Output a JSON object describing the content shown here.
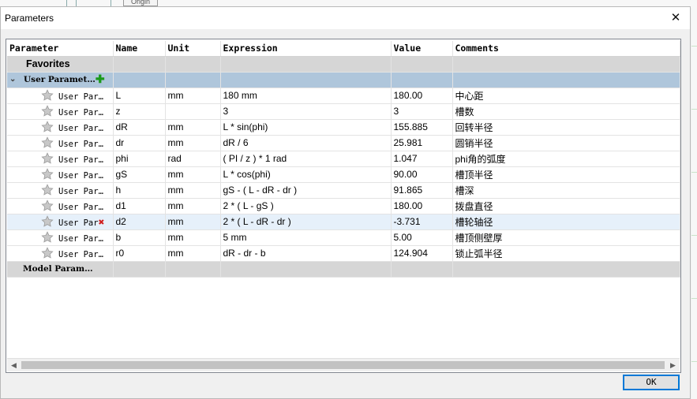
{
  "background": {
    "origin_label": "Origin"
  },
  "dialog": {
    "title": "Parameters",
    "close_glyph": "✕",
    "ok_label": "OK"
  },
  "columns": {
    "parameter": "Parameter",
    "name": "Name",
    "unit": "Unit",
    "expression": "Expression",
    "value": "Value",
    "comments": "Comments"
  },
  "groups": {
    "favorites": "Favorites",
    "user": "User Paramet…",
    "model": "Model Param…"
  },
  "rows": [
    {
      "param": "User Par…",
      "name": "L",
      "unit": "mm",
      "expr": "180 mm",
      "value": "180.00",
      "comment": "中心距"
    },
    {
      "param": "User Par…",
      "name": "z",
      "unit": "",
      "expr": "3",
      "value": "3",
      "comment": "槽数"
    },
    {
      "param": "User Par…",
      "name": "dR",
      "unit": "mm",
      "expr": "L * sin(phi)",
      "value": "155.885",
      "comment": "回转半径"
    },
    {
      "param": "User Par…",
      "name": "dr",
      "unit": "mm",
      "expr": "dR / 6",
      "value": "25.981",
      "comment": "圆销半径"
    },
    {
      "param": "User Par…",
      "name": "phi",
      "unit": "rad",
      "expr": "( PI / z ) * 1 rad",
      "value": "1.047",
      "comment": "phi角的弧度"
    },
    {
      "param": "User Par…",
      "name": "gS",
      "unit": "mm",
      "expr": "L * cos(phi)",
      "value": "90.00",
      "comment": "槽顶半径"
    },
    {
      "param": "User Par…",
      "name": "h",
      "unit": "mm",
      "expr": "gS - ( L - dR - dr )",
      "value": "91.865",
      "comment": "槽深"
    },
    {
      "param": "User Par…",
      "name": "d1",
      "unit": "mm",
      "expr": "2 * ( L - gS )",
      "value": "180.00",
      "comment": "拨盘直径"
    },
    {
      "param": "User Par",
      "name": "d2",
      "unit": "mm",
      "expr": "2 * ( L - dR - dr )",
      "value": "-3.731",
      "comment": "槽轮轴径"
    },
    {
      "param": "User Par…",
      "name": "b",
      "unit": "mm",
      "expr": "5 mm",
      "value": "5.00",
      "comment": "槽顶侧壁厚"
    },
    {
      "param": "User Par…",
      "name": "r0",
      "unit": "mm",
      "expr": "dR - dr - b",
      "value": "124.904",
      "comment": "锁止弧半径"
    }
  ],
  "icons": {
    "expander": "chevron-down-icon",
    "add": "plus-icon",
    "favorite": "star-icon",
    "delete": "delete-x-icon"
  },
  "colors": {
    "group_header": "#afc6db",
    "favorites_bg": "#d6d6d6",
    "selected_row": "#e6f0fa",
    "add_icon": "#1a9a1a",
    "delete_icon": "#d02020",
    "ok_border": "#0078d7"
  }
}
